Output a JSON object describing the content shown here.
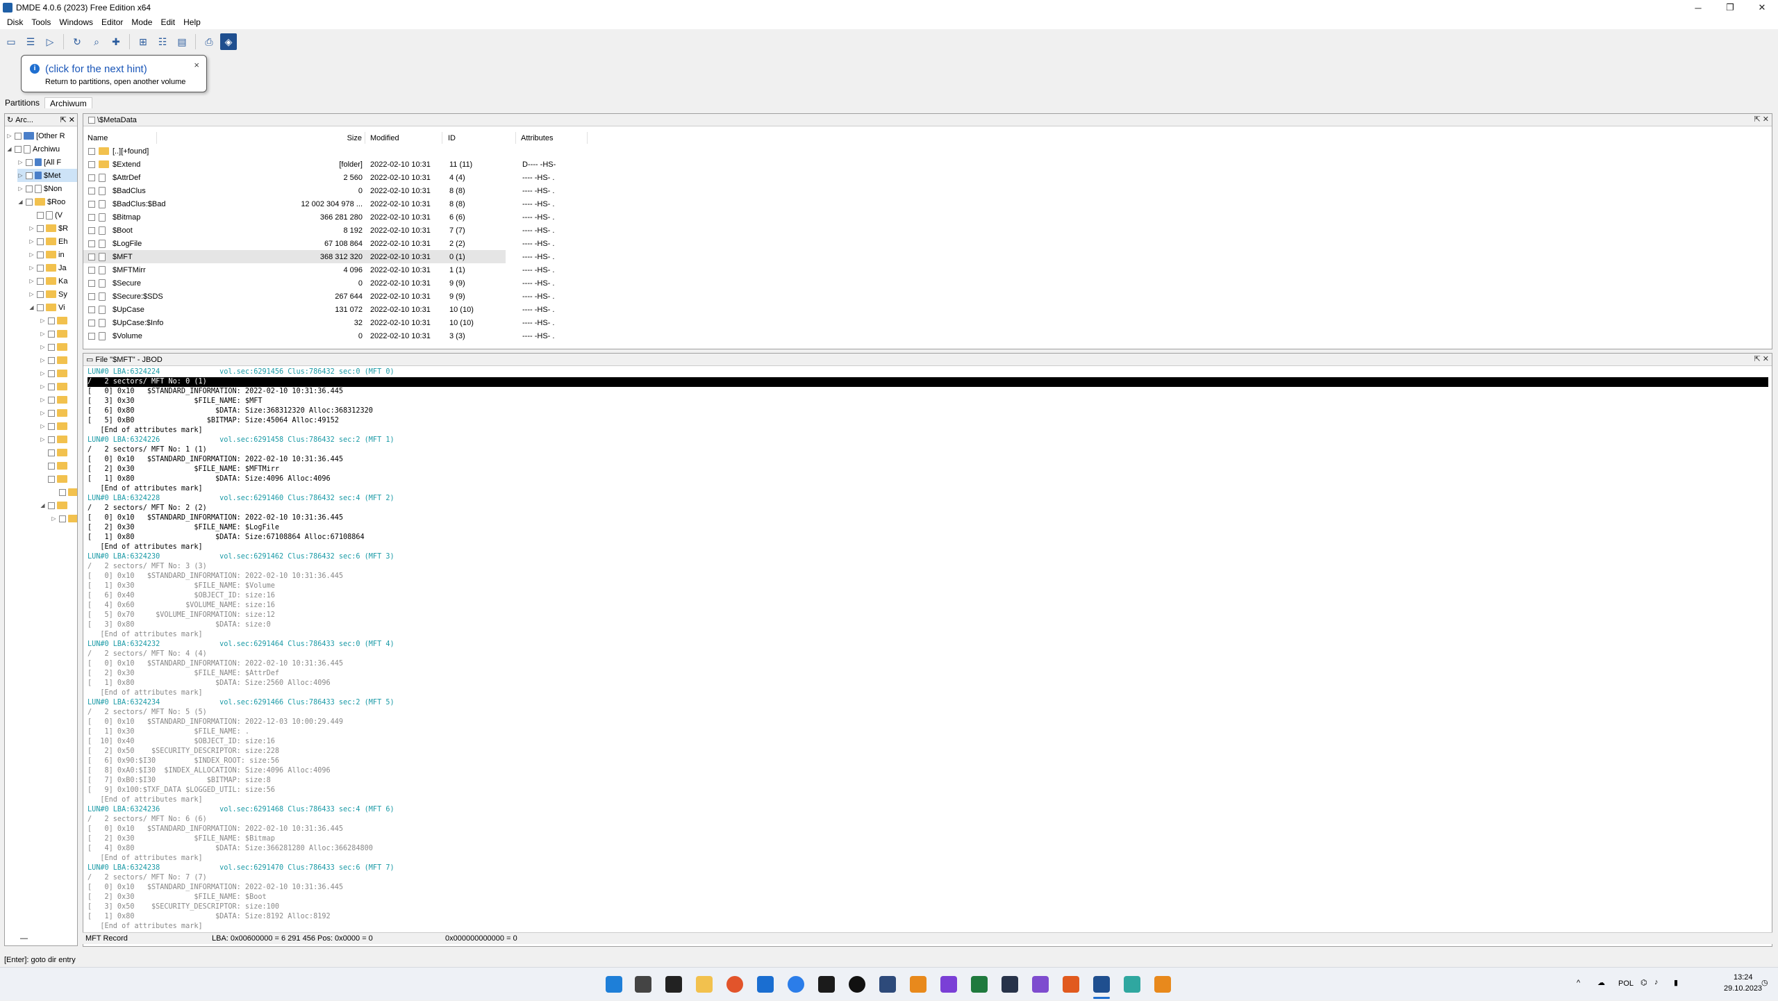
{
  "window": {
    "title": "DMDE 4.0.6 (2023) Free Edition x64",
    "minimize": "─",
    "maximize": "❐",
    "close": "✕"
  },
  "menu": [
    "Disk",
    "Tools",
    "Windows",
    "Editor",
    "Mode",
    "Edit",
    "Help"
  ],
  "hint": {
    "title": "(click for the next hint)",
    "text": "Return to partitions, open another volume",
    "close": "×"
  },
  "tabs": {
    "partitions": "Partitions",
    "archiwum": "Archiwum"
  },
  "left_tree": {
    "header": "Arc...",
    "items": [
      {
        "label": "[Other R"
      },
      {
        "label": "Archiwu"
      },
      {
        "label": "[All F"
      },
      {
        "label": "$Met"
      },
      {
        "label": "$Non"
      },
      {
        "label": "$Roo"
      },
      {
        "label": "(V"
      },
      {
        "label": "$R"
      },
      {
        "label": "Eh"
      },
      {
        "label": "in"
      },
      {
        "label": "Ja"
      },
      {
        "label": "Ka"
      },
      {
        "label": "Sy"
      },
      {
        "label": "Vi"
      }
    ]
  },
  "file_panel": {
    "title": "\\$MetaData",
    "columns": {
      "name": "Name",
      "size": "Size",
      "modified": "Modified",
      "id": "ID",
      "attributes": "Attributes"
    },
    "rows": [
      {
        "name": "[..][+found]",
        "size": "",
        "modified": "",
        "id": "",
        "attr": ""
      },
      {
        "name": "$Extend",
        "size": "[folder]",
        "modified": "2022-02-10 10:31",
        "id": "11 (11)",
        "attr": "D---- -HS-"
      },
      {
        "name": "$AttrDef",
        "size": "2 560",
        "modified": "2022-02-10 10:31",
        "id": "4 (4)",
        "attr": "---- -HS- ."
      },
      {
        "name": "$BadClus",
        "size": "0",
        "modified": "2022-02-10 10:31",
        "id": "8 (8)",
        "attr": "---- -HS- ."
      },
      {
        "name": "$BadClus:$Bad",
        "size": "12 002 304 978 ...",
        "modified": "2022-02-10 10:31",
        "id": "8 (8)",
        "attr": "---- -HS- ."
      },
      {
        "name": "$Bitmap",
        "size": "366 281 280",
        "modified": "2022-02-10 10:31",
        "id": "6 (6)",
        "attr": "---- -HS- ."
      },
      {
        "name": "$Boot",
        "size": "8 192",
        "modified": "2022-02-10 10:31",
        "id": "7 (7)",
        "attr": "---- -HS- ."
      },
      {
        "name": "$LogFile",
        "size": "67 108 864",
        "modified": "2022-02-10 10:31",
        "id": "2 (2)",
        "attr": "---- -HS- ."
      },
      {
        "name": "$MFT",
        "size": "368 312 320",
        "modified": "2022-02-10 10:31",
        "id": "0 (1)",
        "attr": "---- -HS- ."
      },
      {
        "name": "$MFTMirr",
        "size": "4 096",
        "modified": "2022-02-10 10:31",
        "id": "1 (1)",
        "attr": "---- -HS- ."
      },
      {
        "name": "$Secure",
        "size": "0",
        "modified": "2022-02-10 10:31",
        "id": "9 (9)",
        "attr": "---- -HS- ."
      },
      {
        "name": "$Secure:$SDS",
        "size": "267 644",
        "modified": "2022-02-10 10:31",
        "id": "9 (9)",
        "attr": "---- -HS- ."
      },
      {
        "name": "$UpCase",
        "size": "131 072",
        "modified": "2022-02-10 10:31",
        "id": "10 (10)",
        "attr": "---- -HS- ."
      },
      {
        "name": "$UpCase:$Info",
        "size": "32",
        "modified": "2022-02-10 10:31",
        "id": "10 (10)",
        "attr": "---- -HS- ."
      },
      {
        "name": "$Volume",
        "size": "0",
        "modified": "2022-02-10 10:31",
        "id": "3 (3)",
        "attr": "---- -HS- ."
      }
    ]
  },
  "hex_panel": {
    "title": "File \"$MFT\" - JBOD",
    "lines": [
      {
        "t": "LUN#0 LBA:6324224              vol.sec:6291456 Clus:786432 sec:0 (MFT 0)",
        "k": "lba"
      },
      {
        "t": "/   2 sectors/ MFT No: 0 (1)",
        "k": "hi"
      },
      {
        "t": "[   0] 0x10   $STANDARD_INFORMATION: 2022-02-10 10:31:36.445",
        "k": ""
      },
      {
        "t": "[   3] 0x30              $FILE_NAME: $MFT",
        "k": ""
      },
      {
        "t": "[   6] 0x80                   $DATA: Size:368312320 Alloc:368312320",
        "k": ""
      },
      {
        "t": "[   5] 0xB0                 $BITMAP: Size:45064 Alloc:49152",
        "k": ""
      },
      {
        "t": "   [End of attributes mark]",
        "k": ""
      },
      {
        "t": "LUN#0 LBA:6324226              vol.sec:6291458 Clus:786432 sec:2 (MFT 1)",
        "k": "lba"
      },
      {
        "t": "/   2 sectors/ MFT No: 1 (1)",
        "k": ""
      },
      {
        "t": "[   0] 0x10   $STANDARD_INFORMATION: 2022-02-10 10:31:36.445",
        "k": ""
      },
      {
        "t": "[   2] 0x30              $FILE_NAME: $MFTMirr",
        "k": ""
      },
      {
        "t": "[   1] 0x80                   $DATA: Size:4096 Alloc:4096",
        "k": ""
      },
      {
        "t": "   [End of attributes mark]",
        "k": ""
      },
      {
        "t": "LUN#0 LBA:6324228              vol.sec:6291460 Clus:786432 sec:4 (MFT 2)",
        "k": "lba"
      },
      {
        "t": "/   2 sectors/ MFT No: 2 (2)",
        "k": ""
      },
      {
        "t": "[   0] 0x10   $STANDARD_INFORMATION: 2022-02-10 10:31:36.445",
        "k": ""
      },
      {
        "t": "[   2] 0x30              $FILE_NAME: $LogFile",
        "k": ""
      },
      {
        "t": "[   1] 0x80                   $DATA: Size:67108864 Alloc:67108864",
        "k": ""
      },
      {
        "t": "   [End of attributes mark]",
        "k": ""
      },
      {
        "t": "LUN#0 LBA:6324230              vol.sec:6291462 Clus:786432 sec:6 (MFT 3)",
        "k": "lba"
      },
      {
        "t": "/   2 sectors/ MFT No: 3 (3)",
        "k": "dim"
      },
      {
        "t": "[   0] 0x10   $STANDARD_INFORMATION: 2022-02-10 10:31:36.445",
        "k": "dim"
      },
      {
        "t": "[   1] 0x30              $FILE_NAME: $Volume",
        "k": "dim"
      },
      {
        "t": "[   6] 0x40              $OBJECT_ID: size:16",
        "k": "dim"
      },
      {
        "t": "[   4] 0x60            $VOLUME_NAME: size:16",
        "k": "dim"
      },
      {
        "t": "[   5] 0x70     $VOLUME_INFORMATION: size:12",
        "k": "dim"
      },
      {
        "t": "[   3] 0x80                   $DATA: size:0",
        "k": "dim"
      },
      {
        "t": "   [End of attributes mark]",
        "k": "dim"
      },
      {
        "t": "LUN#0 LBA:6324232              vol.sec:6291464 Clus:786433 sec:0 (MFT 4)",
        "k": "lba"
      },
      {
        "t": "/   2 sectors/ MFT No: 4 (4)",
        "k": "dim"
      },
      {
        "t": "[   0] 0x10   $STANDARD_INFORMATION: 2022-02-10 10:31:36.445",
        "k": "dim"
      },
      {
        "t": "[   2] 0x30              $FILE_NAME: $AttrDef",
        "k": "dim"
      },
      {
        "t": "[   1] 0x80                   $DATA: Size:2560 Alloc:4096",
        "k": "dim"
      },
      {
        "t": "   [End of attributes mark]",
        "k": "dim"
      },
      {
        "t": "LUN#0 LBA:6324234              vol.sec:6291466 Clus:786433 sec:2 (MFT 5)",
        "k": "lba"
      },
      {
        "t": "/   2 sectors/ MFT No: 5 (5)",
        "k": "dim"
      },
      {
        "t": "[   0] 0x10   $STANDARD_INFORMATION: 2022-12-03 10:00:29.449",
        "k": "dim"
      },
      {
        "t": "[   1] 0x30              $FILE_NAME: .",
        "k": "dim"
      },
      {
        "t": "[  10] 0x40              $OBJECT_ID: size:16",
        "k": "dim"
      },
      {
        "t": "[   2] 0x50    $SECURITY_DESCRIPTOR: size:228",
        "k": "dim"
      },
      {
        "t": "[   6] 0x90:$I30         $INDEX_ROOT: size:56",
        "k": "dim"
      },
      {
        "t": "[   8] 0xA0:$I30  $INDEX_ALLOCATION: Size:4096 Alloc:4096",
        "k": "dim"
      },
      {
        "t": "[   7] 0xB0:$I30            $BITMAP: size:8",
        "k": "dim"
      },
      {
        "t": "[   9] 0x100:$TXF_DATA $LOGGED_UTIL: size:56",
        "k": "dim"
      },
      {
        "t": "   [End of attributes mark]",
        "k": "dim"
      },
      {
        "t": "LUN#0 LBA:6324236              vol.sec:6291468 Clus:786433 sec:4 (MFT 6)",
        "k": "lba"
      },
      {
        "t": "/   2 sectors/ MFT No: 6 (6)",
        "k": "dim"
      },
      {
        "t": "[   0] 0x10   $STANDARD_INFORMATION: 2022-02-10 10:31:36.445",
        "k": "dim"
      },
      {
        "t": "[   2] 0x30              $FILE_NAME: $Bitmap",
        "k": "dim"
      },
      {
        "t": "[   4] 0x80                   $DATA: Size:366281280 Alloc:366284800",
        "k": "dim"
      },
      {
        "t": "   [End of attributes mark]",
        "k": "dim"
      },
      {
        "t": "LUN#0 LBA:6324238              vol.sec:6291470 Clus:786433 sec:6 (MFT 7)",
        "k": "lba"
      },
      {
        "t": "/   2 sectors/ MFT No: 7 (7)",
        "k": "dim"
      },
      {
        "t": "[   0] 0x10   $STANDARD_INFORMATION: 2022-02-10 10:31:36.445",
        "k": "dim"
      },
      {
        "t": "[   2] 0x30              $FILE_NAME: $Boot",
        "k": "dim"
      },
      {
        "t": "[   3] 0x50    $SECURITY_DESCRIPTOR: size:100",
        "k": "dim"
      },
      {
        "t": "[   1] 0x80                   $DATA: Size:8192 Alloc:8192",
        "k": "dim"
      },
      {
        "t": "   [End of attributes mark]",
        "k": "dim"
      }
    ]
  },
  "pane_status": {
    "mode": "MFT Record",
    "lba": "LBA: 0x00600000 = 6 291 456  Pos: 0x0000 = 0",
    "value": "0x000000000000 = 0",
    "left_dash": "—"
  },
  "status_text": "[Enter]: goto dir entry",
  "tray": {
    "lang": "POL",
    "time": "13:24",
    "date": "29.10.2023",
    "chevron": "^"
  },
  "colors": {
    "accent": "#1f4f8f",
    "lba_line": "#1a9aa6",
    "hint_link": "#1a56b8"
  }
}
